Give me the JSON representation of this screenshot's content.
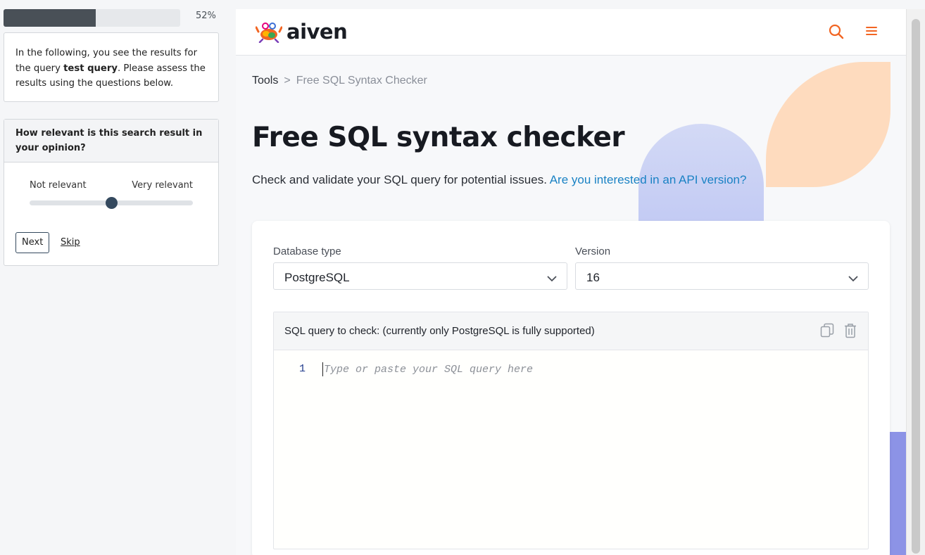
{
  "survey": {
    "progress_value": 0.52,
    "progress_label": "52%",
    "intro_prefix": "In the following, you see the results for the query ",
    "intro_query": "test query",
    "intro_suffix": ". Please assess the results using the questions below.",
    "question": "How relevant is this search result in your opinion?",
    "slider_min_label": "Not relevant",
    "slider_max_label": "Very relevant",
    "slider_value": 0.5,
    "next_label": "Next",
    "skip_label": "Skip"
  },
  "site": {
    "logo_text": "aiven",
    "nav_icons": [
      "search-icon",
      "hamburger-menu-icon"
    ],
    "accent_color": "#f26522",
    "breadcrumb": {
      "root": "Tools",
      "separator": ">",
      "current": "Free SQL Syntax Checker"
    },
    "title": "Free SQL syntax checker",
    "lede_text": "Check and validate your SQL query for potential issues. ",
    "lede_link": "Are you interested in an API version?",
    "database_type": {
      "label": "Database type",
      "value": "PostgreSQL"
    },
    "version": {
      "label": "Version",
      "value": "16"
    },
    "editor": {
      "header": "SQL query to check: (currently only PostgreSQL is fully supported)",
      "line_number": "1",
      "placeholder": "Type or paste your SQL query here",
      "icons": [
        "copy-icon",
        "trash-icon"
      ]
    }
  }
}
